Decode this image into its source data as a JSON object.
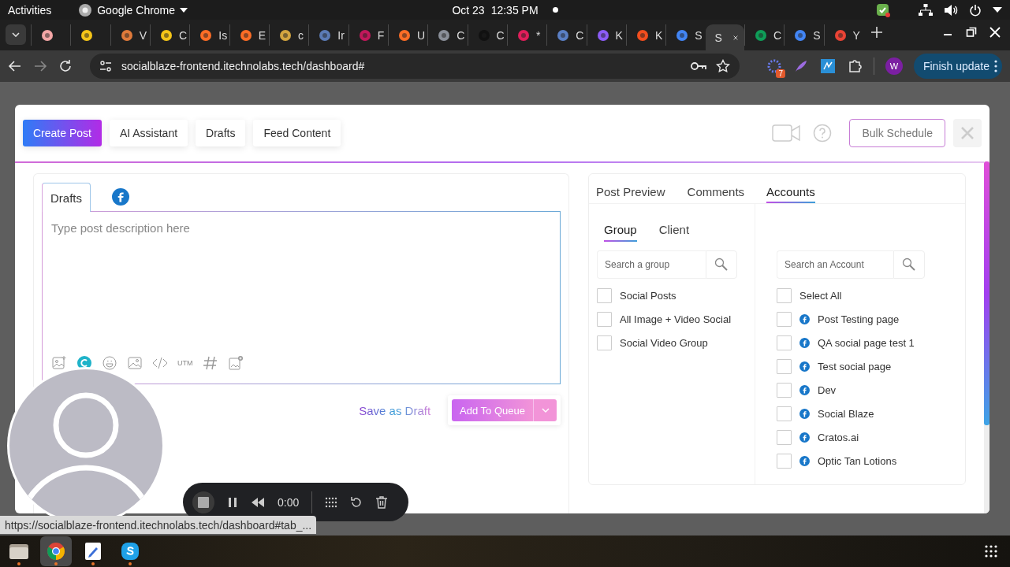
{
  "system_bar": {
    "activities": "Activities",
    "app_name": "Google Chrome",
    "date": "Oct 23",
    "time": "12:35 PM"
  },
  "browser_tabs": [
    {
      "color": "#f4a6a6",
      "selected": false
    },
    {
      "color": "#f5c518",
      "selected": false
    },
    {
      "label": "V",
      "color": "#e07a3a",
      "selected": false
    },
    {
      "label": "C",
      "color": "#f5c518",
      "selected": false
    },
    {
      "label": "Is",
      "color": "#fc6d26",
      "selected": false
    },
    {
      "label": "E",
      "color": "#fc6d26",
      "selected": false
    },
    {
      "label": "c",
      "color": "#d4a640",
      "selected": false
    },
    {
      "label": "Ir",
      "color": "#5b7bb5",
      "selected": false
    },
    {
      "label": "F",
      "color": "#c2185b",
      "selected": false
    },
    {
      "label": "U",
      "color": "#fc6d26",
      "selected": false
    },
    {
      "label": "C",
      "color": "#8a8f99",
      "selected": false
    },
    {
      "label": "C",
      "color": "#111111",
      "selected": false
    },
    {
      "label": "*",
      "color": "#e01e5a",
      "selected": false
    },
    {
      "label": "C",
      "color": "#5a7fc4",
      "selected": false
    },
    {
      "label": "K",
      "color": "#8b5cf6",
      "selected": false
    },
    {
      "label": "K",
      "color": "#f24e1e",
      "selected": false
    },
    {
      "label": "S",
      "color": "#4285f4",
      "selected": false
    },
    {
      "label": "S",
      "selected": true
    },
    {
      "label": "C",
      "color": "#0f9d58",
      "selected": false
    },
    {
      "label": "S",
      "color": "#4285f4",
      "selected": false
    },
    {
      "label": "Y",
      "color": "#ea4335",
      "selected": false
    }
  ],
  "address_bar": {
    "url": "socialblaze-frontend.itechnolabs.tech/dashboard#",
    "extension_badge": "7",
    "profile": "W",
    "update_button": "Finish update"
  },
  "modal": {
    "header_tabs": [
      {
        "label": "Create Post",
        "selected": true
      },
      {
        "label": "AI Assistant",
        "selected": false
      },
      {
        "label": "Drafts",
        "selected": false
      },
      {
        "label": "Feed Content",
        "selected": false
      }
    ],
    "bulk_button": "Bulk Schedule",
    "editor": {
      "tabs": [
        {
          "kind": "text",
          "label": "Drafts",
          "selected": true
        },
        {
          "kind": "facebook",
          "selected": false
        }
      ],
      "placeholder": "Type post description here",
      "toolbar": [
        {
          "kind": "image-add"
        },
        {
          "kind": "canva"
        },
        {
          "kind": "emoji"
        },
        {
          "kind": "image"
        },
        {
          "kind": "code"
        },
        {
          "kind": "text",
          "label": "UTM"
        },
        {
          "kind": "hashtag"
        },
        {
          "kind": "gallery-add"
        }
      ],
      "save_draft": "Save as Draft",
      "add_queue": "Add To Queue"
    },
    "preview": {
      "tabs": [
        {
          "label": "Post Preview",
          "selected": false
        },
        {
          "label": "Comments",
          "selected": false
        },
        {
          "label": "Accounts",
          "selected": true
        }
      ],
      "subtabs": [
        {
          "label": "Group",
          "selected": true
        },
        {
          "label": "Client",
          "selected": false
        }
      ],
      "group_search": {
        "placeholder": "Search a group"
      },
      "groups": [
        {
          "label": "Social Posts",
          "checked": false
        },
        {
          "label": "All Image + Video Social",
          "checked": false
        },
        {
          "label": "Social Video Group",
          "checked": false
        }
      ],
      "account_search": {
        "placeholder": "Search an Account"
      },
      "select_all": {
        "label": "Select All",
        "checked": false
      },
      "accounts": [
        {
          "label": "Post Testing page",
          "kind": "facebook",
          "checked": false
        },
        {
          "label": "QA social page test 1",
          "kind": "facebook",
          "checked": false
        },
        {
          "label": "Test social page",
          "kind": "facebook",
          "checked": false
        },
        {
          "label": "Dev",
          "kind": "facebook",
          "checked": false
        },
        {
          "label": "Social Blaze",
          "kind": "facebook",
          "checked": false
        },
        {
          "label": "Cratos.ai",
          "kind": "facebook",
          "checked": false
        },
        {
          "label": "Optic Tan Lotions",
          "kind": "facebook",
          "checked": false
        }
      ]
    }
  },
  "recorder": {
    "time": "0:00"
  },
  "status_url": "https://socialblaze-frontend.itechnolabs.tech/dashboard#tab_...",
  "taskbar": [
    {
      "kind": "files",
      "selected": false
    },
    {
      "kind": "chrome",
      "selected": true
    },
    {
      "kind": "editor",
      "selected": false
    },
    {
      "kind": "skype",
      "selected": false
    }
  ]
}
